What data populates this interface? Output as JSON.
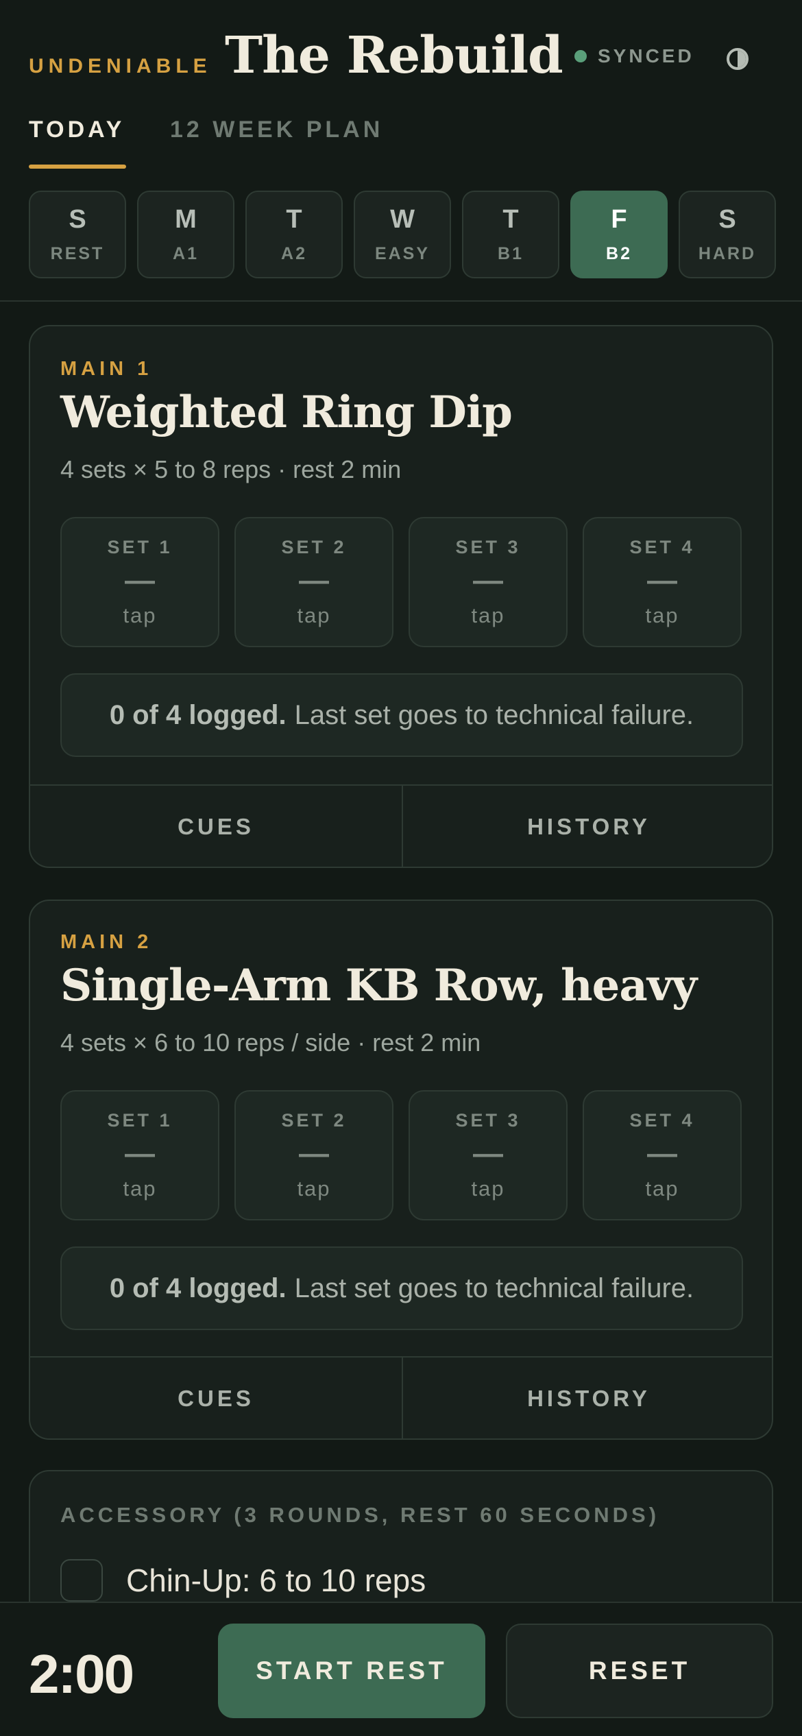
{
  "header": {
    "brand": "UNDENIABLE",
    "title": "The Rebuild",
    "sync_status": "SYNCED",
    "tabs": [
      {
        "label": "TODAY",
        "active": true
      },
      {
        "label": "12 WEEK PLAN",
        "active": false
      }
    ],
    "days": [
      {
        "letter": "S",
        "label": "REST",
        "active": false
      },
      {
        "letter": "M",
        "label": "A1",
        "active": false
      },
      {
        "letter": "T",
        "label": "A2",
        "active": false
      },
      {
        "letter": "W",
        "label": "EASY",
        "active": false
      },
      {
        "letter": "T",
        "label": "B1",
        "active": false
      },
      {
        "letter": "F",
        "label": "B2",
        "active": true
      },
      {
        "letter": "S",
        "label": "HARD",
        "active": false
      }
    ]
  },
  "exercises": [
    {
      "kicker": "MAIN 1",
      "title": "Weighted Ring Dip",
      "meta": "4 sets × 5 to 8 reps · rest 2 min",
      "sets": [
        {
          "label": "SET 1",
          "value": "—",
          "hint": "tap"
        },
        {
          "label": "SET 2",
          "value": "—",
          "hint": "tap"
        },
        {
          "label": "SET 3",
          "value": "—",
          "hint": "tap"
        },
        {
          "label": "SET 4",
          "value": "—",
          "hint": "tap"
        }
      ],
      "logged": "0 of 4 logged.",
      "note": "Last set goes to technical failure.",
      "actions": [
        "CUES",
        "HISTORY"
      ]
    },
    {
      "kicker": "MAIN 2",
      "title": "Single-Arm KB Row, heavy",
      "meta": "4 sets × 6 to 10 reps / side · rest 2 min",
      "sets": [
        {
          "label": "SET 1",
          "value": "—",
          "hint": "tap"
        },
        {
          "label": "SET 2",
          "value": "—",
          "hint": "tap"
        },
        {
          "label": "SET 3",
          "value": "—",
          "hint": "tap"
        },
        {
          "label": "SET 4",
          "value": "—",
          "hint": "tap"
        }
      ],
      "logged": "0 of 4 logged.",
      "note": "Last set goes to technical failure.",
      "actions": [
        "CUES",
        "HISTORY"
      ]
    }
  ],
  "accessory": {
    "title": "ACCESSORY (3 ROUNDS, REST 60 SECONDS)",
    "items": [
      {
        "label": "Chin-Up: 6 to 10 reps",
        "checked": false
      }
    ]
  },
  "footer": {
    "timer": "2:00",
    "start_label": "START REST",
    "reset_label": "RESET"
  },
  "colors": {
    "accent_gold": "#d6a142",
    "accent_green": "#3d6b53",
    "background": "#121915",
    "sync_dot": "#5a9f7a"
  },
  "icons": {
    "sync": "status-dot-icon",
    "theme": "half-circle-contrast-icon"
  }
}
